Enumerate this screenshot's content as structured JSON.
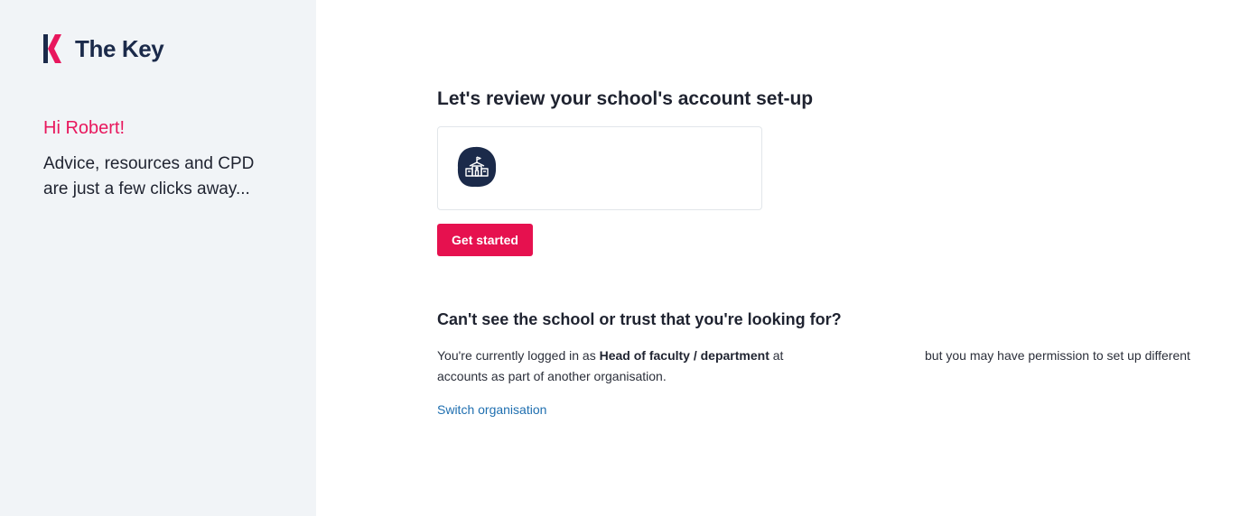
{
  "sidebar": {
    "logo_text": "The Key",
    "greeting": "Hi Robert!",
    "tagline": "Advice, resources and CPD are just a few clicks away..."
  },
  "main": {
    "review_heading": "Let's review your school's account set-up",
    "school_card": {
      "icon": "school-building-icon",
      "name": ""
    },
    "get_started_label": "Get started",
    "cant_see_heading": "Can't see the school or trust that you're looking for?",
    "info": {
      "prefix": "You're currently logged in as ",
      "role": "Head of faculty / department",
      "at": " at",
      "suffix": "but you may have permission to set up different",
      "line2": "accounts as part of another organisation."
    },
    "switch_link": "Switch organisation"
  },
  "colors": {
    "brand_pink": "#e8175d",
    "button_pink": "#e6114f",
    "navy": "#1b2a4a",
    "link_blue": "#1f6fb0",
    "sidebar_bg": "#f1f4f7"
  }
}
